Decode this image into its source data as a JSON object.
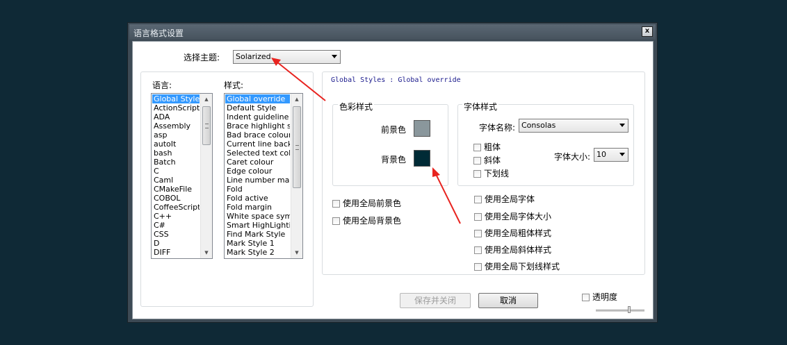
{
  "window": {
    "title": "语言格式设置",
    "close_label": "x"
  },
  "theme": {
    "label": "选择主题:",
    "selected": "Solarized"
  },
  "languages": {
    "label": "语言:",
    "items": [
      "Global Styles",
      "ActionScript",
      "ADA",
      "Assembly",
      "asp",
      "autoIt",
      "bash",
      "Batch",
      "C",
      "Caml",
      "CMakeFile",
      "COBOL",
      "CoffeeScript",
      "C++",
      "C#",
      "CSS",
      "D",
      "DIFF"
    ],
    "selected_index": 0
  },
  "styles": {
    "label": "样式:",
    "items": [
      "Global override",
      "Default Style",
      "Indent guideline style",
      "Brace highlight style",
      "Bad brace colour",
      "Current line background colour",
      "Selected text colour",
      "Caret colour",
      "Edge colour",
      "Line number margin",
      "Fold",
      "Fold active",
      "Fold margin",
      "White space symbol",
      "Smart HighLighting",
      "Find Mark Style",
      "Mark Style 1",
      "Mark Style 2"
    ],
    "selected_index": 0
  },
  "header_text": "Global Styles : Global override",
  "color_group": {
    "title": "色彩样式",
    "fg_label": "前景色",
    "bg_label": "背景色",
    "fg_color": "#8a979c",
    "bg_color": "#002b36"
  },
  "font_group": {
    "title": "字体样式",
    "name_label": "字体名称:",
    "name_value": "Consolas",
    "bold_label": "粗体",
    "italic_label": "斜体",
    "underline_label": "下划线",
    "size_label": "字体大小:",
    "size_value": "10"
  },
  "global_fg_label": "使用全局前景色",
  "global_bg_label": "使用全局背景色",
  "global_options": [
    "使用全局字体",
    "使用全局字体大小",
    "使用全局粗体样式",
    "使用全局斜体样式",
    "使用全局下划线样式"
  ],
  "buttons": {
    "save_close": "保存并关闭",
    "cancel": "取消"
  },
  "transparency_label": "透明度",
  "colors": {
    "annotation_arrow": "#e8231f",
    "selection": "#3399ff"
  }
}
